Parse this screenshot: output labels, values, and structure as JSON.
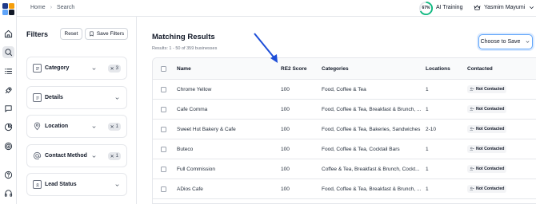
{
  "breadcrumb": {
    "home": "Home",
    "current": "Search"
  },
  "progress": {
    "percent_text": "67%",
    "fraction": 0.67,
    "color": "#10b981"
  },
  "header": {
    "ai_training": "AI Training",
    "user_name": "Yasmim Mayumi"
  },
  "filters": {
    "title": "Filters",
    "reset_label": "Reset",
    "save_label": "Save Filters",
    "items": [
      {
        "label": "Category",
        "icon": "category-icon",
        "badge": "3"
      },
      {
        "label": "Details",
        "icon": "details-icon",
        "badge": ""
      },
      {
        "label": "Location",
        "icon": "location-pin-icon",
        "badge": "1"
      },
      {
        "label": "Contact Method",
        "icon": "at-sign-icon",
        "badge": "1"
      },
      {
        "label": "Lead Status",
        "icon": "lead-status-icon",
        "badge": ""
      }
    ]
  },
  "results": {
    "title": "Matching Results",
    "count": "Results: 1 - 50 of 359 businesses",
    "choose_save": "Choose to Save",
    "columns": [
      "Name",
      "RE2 Score",
      "Categories",
      "Locations",
      "Contacted"
    ],
    "rows": [
      {
        "name": "Chrome Yellow",
        "score": "100",
        "categories": "Food, Coffee & Tea",
        "locations": "1",
        "contacted": "Not Contacted"
      },
      {
        "name": "Cafe Comma",
        "score": "100",
        "categories": "Food, Coffee & Tea, Breakfast & Brunch, ...",
        "locations": "1",
        "contacted": "Not Contacted"
      },
      {
        "name": "Sweet Hut Bakery & Cafe",
        "score": "100",
        "categories": "Food, Coffee & Tea, Bakeries, Sandwiches",
        "locations": "2-10",
        "contacted": "Not Contacted"
      },
      {
        "name": "Buteco",
        "score": "100",
        "categories": "Food, Coffee & Tea, Cocktail Bars",
        "locations": "1",
        "contacted": "Not Contacted"
      },
      {
        "name": "Full Commission",
        "score": "100",
        "categories": "Coffee & Tea, Breakfast & Brunch, Cockt...",
        "locations": "1",
        "contacted": "Not Contacted"
      },
      {
        "name": "ADios Cafe",
        "score": "100",
        "categories": "Food, Coffee & Tea, Breakfast & Brunch, ...",
        "locations": "1",
        "contacted": "Not Contacted"
      }
    ]
  },
  "colors": {
    "accent": "#2563eb",
    "arrow": "#1d4ed8",
    "progress": "#10b981"
  }
}
